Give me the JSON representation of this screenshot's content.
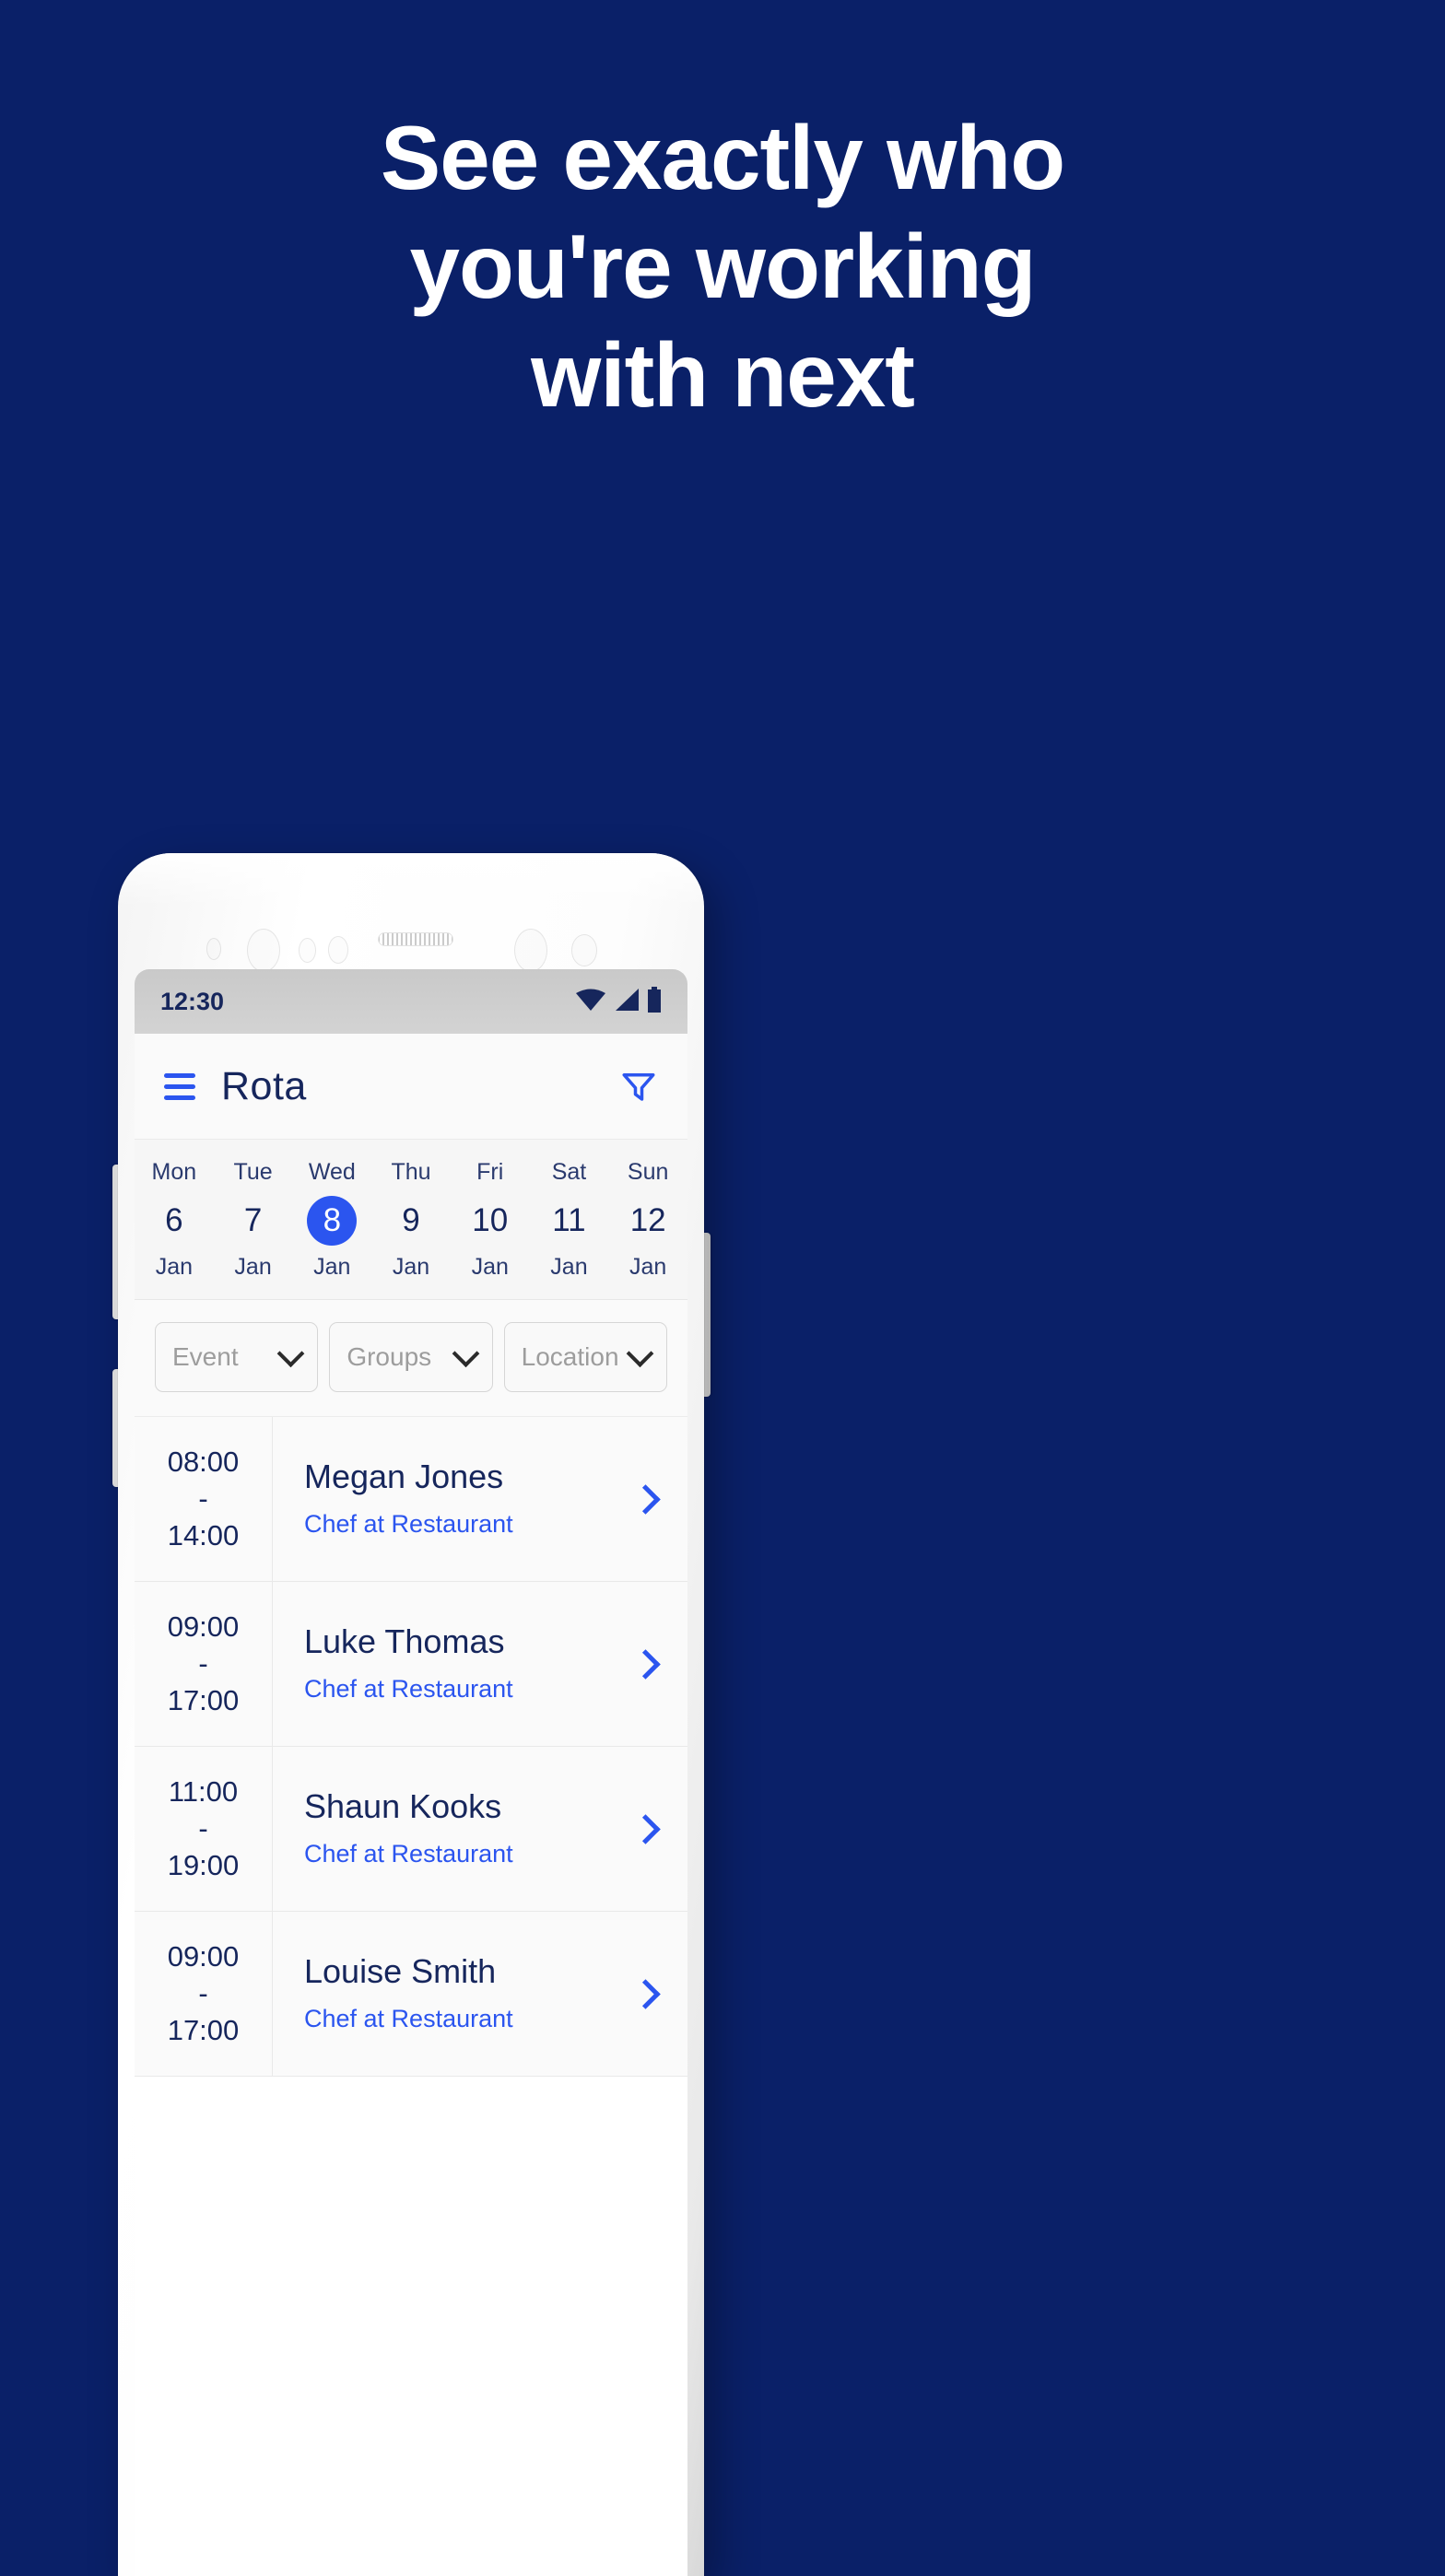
{
  "hero": {
    "lines": [
      "See exactly who",
      "you're working",
      "with next"
    ],
    "background_color": "#0a2068",
    "text_color": "#ffffff"
  },
  "phone": {
    "status_bar": {
      "time": "12:30",
      "icons": [
        "wifi-icon",
        "cellular-signal-icon",
        "battery-icon"
      ]
    },
    "app_bar": {
      "menu_icon": "hamburger-menu-icon",
      "title": "Rota",
      "filter_icon": "filter-funnel-icon",
      "accent_color": "#2b55ef",
      "title_color": "#16265c"
    },
    "date_strip": {
      "days": [
        {
          "name": "Mon",
          "date": "6",
          "month": "Jan",
          "selected": false
        },
        {
          "name": "Tue",
          "date": "7",
          "month": "Jan",
          "selected": false
        },
        {
          "name": "Wed",
          "date": "8",
          "month": "Jan",
          "selected": true
        },
        {
          "name": "Thu",
          "date": "9",
          "month": "Jan",
          "selected": false
        },
        {
          "name": "Fri",
          "date": "10",
          "month": "Jan",
          "selected": false
        },
        {
          "name": "Sat",
          "date": "11",
          "month": "Jan",
          "selected": false
        },
        {
          "name": "Sun",
          "date": "12",
          "month": "Jan",
          "selected": false
        }
      ],
      "selected_color": "#2b55ef"
    },
    "filters": [
      {
        "label": "Event",
        "icon": "chevron-down-icon"
      },
      {
        "label": "Groups",
        "icon": "chevron-down-icon"
      },
      {
        "label": "Location",
        "icon": "chevron-down-icon"
      }
    ],
    "shifts": [
      {
        "start": "08:00",
        "dash": "-",
        "end": "14:00",
        "name": "Megan Jones",
        "role": "Chef at Restaurant",
        "chevron": "chevron-right-icon"
      },
      {
        "start": "09:00",
        "dash": "-",
        "end": "17:00",
        "name": "Luke Thomas",
        "role": "Chef at Restaurant",
        "chevron": "chevron-right-icon"
      },
      {
        "start": "11:00",
        "dash": "-",
        "end": "19:00",
        "name": "Shaun Kooks",
        "role": "Chef at Restaurant",
        "chevron": "chevron-right-icon"
      },
      {
        "start": "09:00",
        "dash": "-",
        "end": "17:00",
        "name": "Louise Smith",
        "role": "Chef at Restaurant",
        "chevron": "chevron-right-icon"
      }
    ]
  }
}
